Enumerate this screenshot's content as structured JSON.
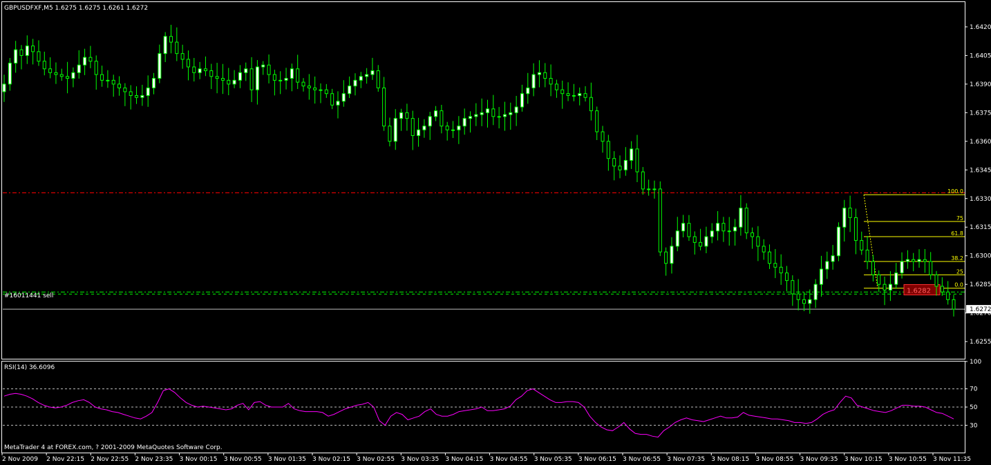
{
  "main_panel": {
    "header": "GBPUSDFXF,M5  1.6275 1.6275 1.6261 1.6272",
    "y_range": [
      1.6246,
      1.6433
    ],
    "y_ticks": [
      "1.6420",
      "1.6405",
      "1.6390",
      "1.6375",
      "1.6360",
      "1.6345",
      "1.6330",
      "1.6315",
      "1.6300",
      "1.6285",
      "1.6270",
      "1.6255"
    ],
    "current_price": "1.6272",
    "order_label": "#16011441 sell",
    "order_price": 1.6281,
    "stop_line_price": 1.6333,
    "current_price_line": 1.6272,
    "fib": {
      "levels": [
        {
          "label": "100.0",
          "price": 1.6332
        },
        {
          "label": "75",
          "price": 1.6318
        },
        {
          "label": "61.8",
          "price": 1.631
        },
        {
          "label": "38.2",
          "price": 1.6297
        },
        {
          "label": "25",
          "price": 1.629
        },
        {
          "label": "0.0",
          "price": 1.6283
        }
      ]
    },
    "price_tag": "1.6282"
  },
  "rsi_panel": {
    "header": "RSI(14) 36.6096",
    "y_range": [
      0,
      100
    ],
    "y_ticks": [
      "100",
      "70",
      "50",
      "30"
    ]
  },
  "x_labels": [
    "2 Nov 2009",
    "2 Nov 22:15",
    "2 Nov 22:55",
    "2 Nov 23:35",
    "3 Nov 00:15",
    "3 Nov 00:55",
    "3 Nov 01:35",
    "3 Nov 02:15",
    "3 Nov 02:55",
    "3 Nov 03:35",
    "3 Nov 04:15",
    "3 Nov 04:55",
    "3 Nov 05:35",
    "3 Nov 06:15",
    "3 Nov 06:55",
    "3 Nov 07:35",
    "3 Nov 08:15",
    "3 Nov 08:55",
    "3 Nov 09:35",
    "3 Nov 10:15",
    "3 Nov 10:55",
    "3 Nov 11:35"
  ],
  "copyright": "MetaTrader 4 at FOREX.com, ? 2001-2009 MetaQuotes Software Corp.",
  "colors": {
    "bull": "#ffffff",
    "bear": "#000000",
    "wick": "#00ff00",
    "rsi": "#ff00ff",
    "fib": "#ffff00",
    "stop": "#ff0000",
    "order": "#00ff00",
    "frame": "#ffffff"
  },
  "chart_data": {
    "type": "candlestick",
    "title": "GBPUSDFXF,M5",
    "closes": [
      1.639,
      1.6401,
      1.6408,
      1.6405,
      1.641,
      1.6407,
      1.6402,
      1.6398,
      1.6396,
      1.6395,
      1.6394,
      1.6393,
      1.6396,
      1.64,
      1.6404,
      1.6402,
      1.6395,
      1.6392,
      1.6392,
      1.639,
      1.6388,
      1.6386,
      1.6384,
      1.6383,
      1.6384,
      1.6388,
      1.6393,
      1.6406,
      1.6415,
      1.6412,
      1.6406,
      1.6403,
      1.6399,
      1.6396,
      1.6398,
      1.6397,
      1.6394,
      1.6393,
      1.6392,
      1.639,
      1.6392,
      1.6396,
      1.6398,
      1.6387,
      1.6399,
      1.64,
      1.6395,
      1.6392,
      1.6392,
      1.6393,
      1.6398,
      1.6391,
      1.6389,
      1.6388,
      1.6387,
      1.6387,
      1.6385,
      1.6379,
      1.6381,
      1.6385,
      1.6389,
      1.6392,
      1.6394,
      1.6395,
      1.6397,
      1.6388,
      1.6368,
      1.636,
      1.6372,
      1.6375,
      1.6372,
      1.6363,
      1.6366,
      1.6368,
      1.6373,
      1.6376,
      1.6368,
      1.6366,
      1.6366,
      1.6368,
      1.6372,
      1.6373,
      1.6374,
      1.6375,
      1.6377,
      1.6373,
      1.6373,
      1.6374,
      1.6375,
      1.6378,
      1.6385,
      1.6388,
      1.6395,
      1.6396,
      1.6393,
      1.639,
      1.6387,
      1.6385,
      1.6384,
      1.6384,
      1.6385,
      1.6383,
      1.6376,
      1.6365,
      1.636,
      1.6351,
      1.6347,
      1.6345,
      1.635,
      1.6356,
      1.6344,
      1.6335,
      1.6335,
      1.6335,
      1.6302,
      1.6296,
      1.6305,
      1.6313,
      1.6317,
      1.631,
      1.6307,
      1.6305,
      1.631,
      1.6313,
      1.6317,
      1.6313,
      1.6313,
      1.6315,
      1.6325,
      1.6312,
      1.631,
      1.6305,
      1.6302,
      1.6296,
      1.6294,
      1.6291,
      1.6287,
      1.628,
      1.6277,
      1.6275,
      1.6277,
      1.6285,
      1.6293,
      1.6297,
      1.63,
      1.6315,
      1.6325,
      1.632,
      1.6308,
      1.6303,
      1.6297,
      1.629,
      1.6285,
      1.6282,
      1.6285,
      1.6291,
      1.6297,
      1.6298,
      1.6297,
      1.6298,
      1.6297,
      1.629,
      1.6284,
      1.6281,
      1.6277,
      1.6272
    ],
    "rsi": [
      62,
      64,
      65,
      64,
      62,
      59,
      55,
      52,
      50,
      49,
      50,
      52,
      55,
      57,
      58,
      55,
      50,
      48,
      47,
      45,
      44,
      42,
      40,
      38,
      37,
      40,
      44,
      55,
      68,
      70,
      66,
      60,
      55,
      52,
      50,
      51,
      50,
      49,
      48,
      47,
      48,
      52,
      54,
      47,
      55,
      56,
      52,
      50,
      50,
      50,
      54,
      48,
      46,
      45,
      45,
      45,
      44,
      40,
      42,
      45,
      48,
      50,
      52,
      53,
      55,
      50,
      35,
      30,
      40,
      44,
      42,
      36,
      38,
      40,
      45,
      48,
      42,
      40,
      40,
      42,
      45,
      46,
      47,
      48,
      50,
      46,
      46,
      47,
      48,
      51,
      58,
      62,
      68,
      70,
      66,
      62,
      58,
      55,
      55,
      56,
      56,
      55,
      50,
      40,
      33,
      28,
      25,
      24,
      28,
      33,
      26,
      21,
      20,
      20,
      18,
      17,
      24,
      28,
      33,
      36,
      38,
      36,
      35,
      34,
      36,
      38,
      40,
      38,
      38,
      39,
      44,
      41,
      40,
      39,
      38,
      37,
      37,
      36,
      35,
      33,
      33,
      32,
      33,
      37,
      42,
      45,
      47,
      55,
      62,
      60,
      52,
      50,
      48,
      46,
      45,
      44,
      46,
      49,
      52,
      52,
      51,
      51,
      50,
      47,
      44,
      43,
      40,
      37
    ]
  }
}
